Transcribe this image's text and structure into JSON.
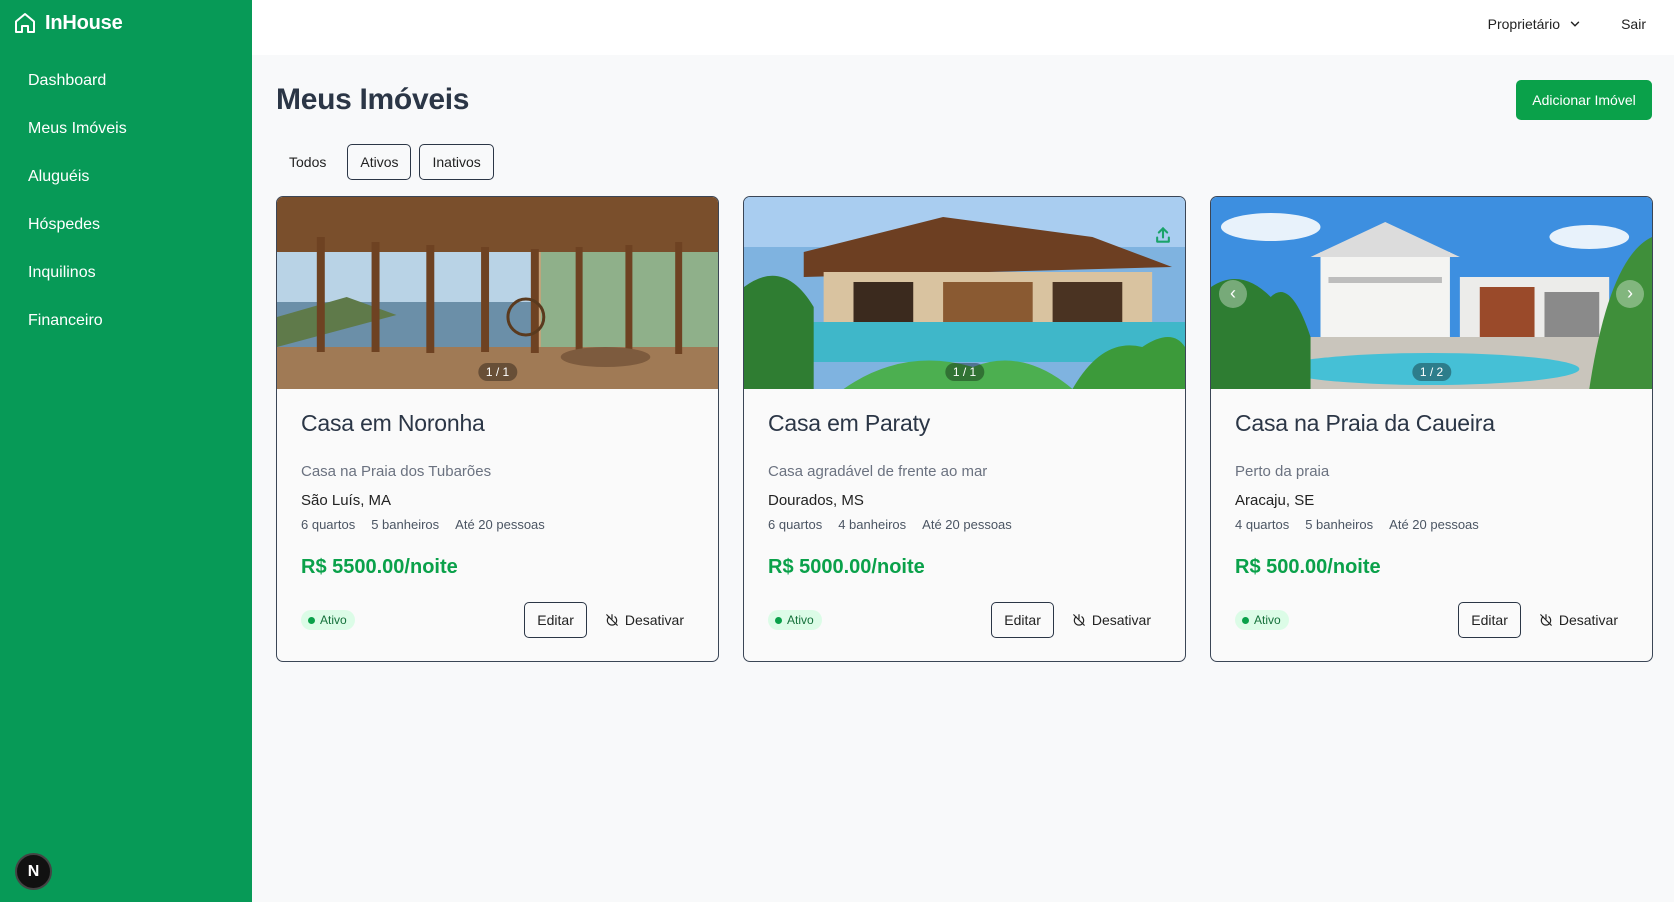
{
  "app": {
    "name": "InHouse"
  },
  "sidebar": {
    "items": [
      {
        "label": "Dashboard"
      },
      {
        "label": "Meus Imóveis"
      },
      {
        "label": "Aluguéis"
      },
      {
        "label": "Hóspedes"
      },
      {
        "label": "Inquilinos"
      },
      {
        "label": "Financeiro"
      }
    ],
    "badge": "N"
  },
  "header": {
    "role": "Proprietário",
    "logout": "Sair"
  },
  "page": {
    "title": "Meus Imóveis",
    "add_button": "Adicionar Imóvel"
  },
  "filters": [
    {
      "label": "Todos"
    },
    {
      "label": "Ativos"
    },
    {
      "label": "Inativos"
    }
  ],
  "properties": [
    {
      "title": "Casa em Noronha",
      "description": "Casa na Praia dos Tubarões",
      "location": "São Luís, MA",
      "bedrooms": "6 quartos",
      "bathrooms": "5 banheiros",
      "capacity": "Até 20 pessoas",
      "price": "R$ 5500.00/noite",
      "status": "Ativo",
      "image_counter": "1 / 1",
      "edit": "Editar",
      "deactivate": "Desativar"
    },
    {
      "title": "Casa em Paraty",
      "description": "Casa agradável de frente ao mar",
      "location": "Dourados, MS",
      "bedrooms": "6 quartos",
      "bathrooms": "4 banheiros",
      "capacity": "Até 20 pessoas",
      "price": "R$ 5000.00/noite",
      "status": "Ativo",
      "image_counter": "1 / 1",
      "edit": "Editar",
      "deactivate": "Desativar"
    },
    {
      "title": "Casa na Praia da Caueira",
      "description": "Perto da praia",
      "location": "Aracaju, SE",
      "bedrooms": "4 quartos",
      "bathrooms": "5 banheiros",
      "capacity": "Até 20 pessoas",
      "price": "R$ 500.00/noite",
      "status": "Ativo",
      "image_counter": "1 / 2",
      "edit": "Editar",
      "deactivate": "Desativar"
    }
  ],
  "colors": {
    "sidebar": "#079a57",
    "accent": "#0aa14a",
    "title": "#2b3646"
  },
  "icons": {
    "brand": "home-icon",
    "role": "chevron-down-icon",
    "deactivate": "power-off-icon",
    "share": "share-icon"
  }
}
